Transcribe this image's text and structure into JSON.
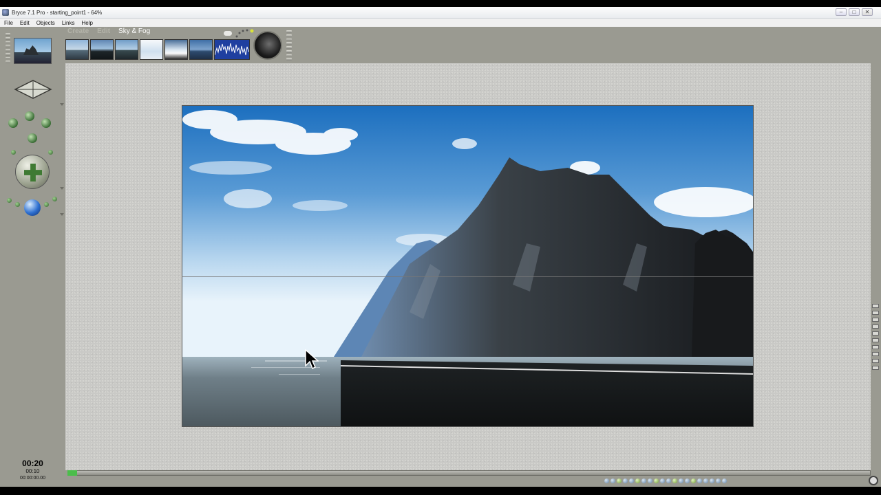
{
  "window": {
    "title": "Bryce 7.1 Pro - starting_point1 - 64%",
    "controls": {
      "minimize": "–",
      "maximize": "□",
      "close": "✕"
    }
  },
  "menu": {
    "items": [
      "File",
      "Edit",
      "Objects",
      "Links",
      "Help"
    ]
  },
  "toolbar": {
    "tabs": {
      "create": "Create",
      "edit": "Edit",
      "sky_fog": "Sky & Fog"
    },
    "presets": [
      "sky-preset-1",
      "sky-preset-2",
      "sky-preset-3",
      "sky-preset-4",
      "sky-preset-5",
      "sky-preset-6"
    ],
    "histogram_icon": "histogram-icon",
    "sun_icon": "sun-sphere-icon"
  },
  "left_panel": {
    "nav_preview_icon": "nav-preview-icon",
    "camera_cross_icon": "camera-cross-icon",
    "trackball_icon": "trackball-icon",
    "move_icon": "camera-move-icon",
    "blue_sphere_icon": "blue-sphere-icon"
  },
  "time": {
    "current": "00:20",
    "frame": "00:10",
    "timecode": "00:00:00.00"
  },
  "render": {
    "sky_top_color": "#1b74c6",
    "sky_bottom_color": "#e4f1fb",
    "rock_color": "#1c1e20",
    "water_color": "#2a2e30"
  }
}
